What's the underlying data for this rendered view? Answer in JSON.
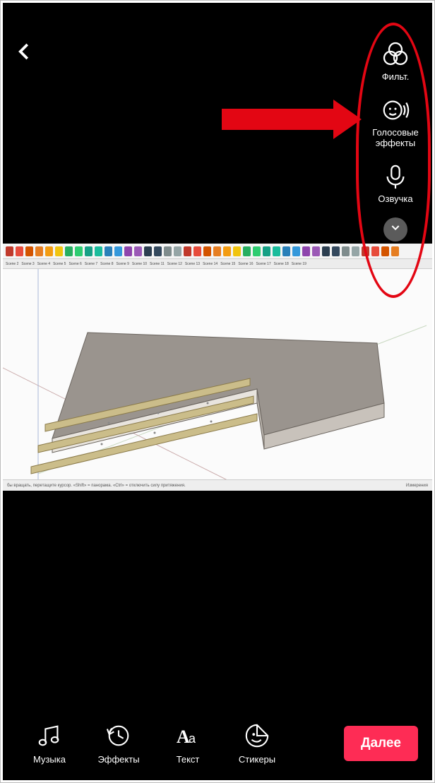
{
  "sidebar": {
    "filters_label": "Фильт.",
    "voice_effects_label": "Голосовые эффекты",
    "voiceover_label": "Озвучка"
  },
  "bottom": {
    "music_label": "Музыка",
    "effects_label": "Эффекты",
    "text_label": "Текст",
    "stickers_label": "Стикеры",
    "next_label": "Далее"
  },
  "preview": {
    "scenes": [
      "Scene 2",
      "Scene 3",
      "Scene 4",
      "Scene 5",
      "Scene 6",
      "Scene 7",
      "Scene 8",
      "Scene 9",
      "Scene 10",
      "Scene 11",
      "Scene 12",
      "Scene 13",
      "Scene 14",
      "Scene 15",
      "Scene 16",
      "Scene 17",
      "Scene 18",
      "Scene 19"
    ],
    "status_left": "бы вращать, перетащите курсор. «Shift» = панорама. «Ctrl» = отключить силу притяжения.",
    "status_right": "Измерения",
    "toolbar_colors": [
      "#c0392b",
      "#e74c3c",
      "#d35400",
      "#e67e22",
      "#f39c12",
      "#f1c40f",
      "#27ae60",
      "#2ecc71",
      "#16a085",
      "#1abc9c",
      "#2980b9",
      "#3498db",
      "#8e44ad",
      "#9b59b6",
      "#2c3e50",
      "#34495e",
      "#7f8c8d",
      "#95a5a6",
      "#c0392b",
      "#e74c3c",
      "#d35400",
      "#e67e22",
      "#f39c12",
      "#f1c40f",
      "#27ae60",
      "#2ecc71",
      "#16a085",
      "#1abc9c",
      "#2980b9",
      "#3498db",
      "#8e44ad",
      "#9b59b6",
      "#2c3e50",
      "#34495e",
      "#7f8c8d",
      "#95a5a6",
      "#c0392b",
      "#e74c3c",
      "#d35400",
      "#e67e22"
    ]
  },
  "colors": {
    "accent": "#fe2c55",
    "annotation": "#e30613"
  }
}
